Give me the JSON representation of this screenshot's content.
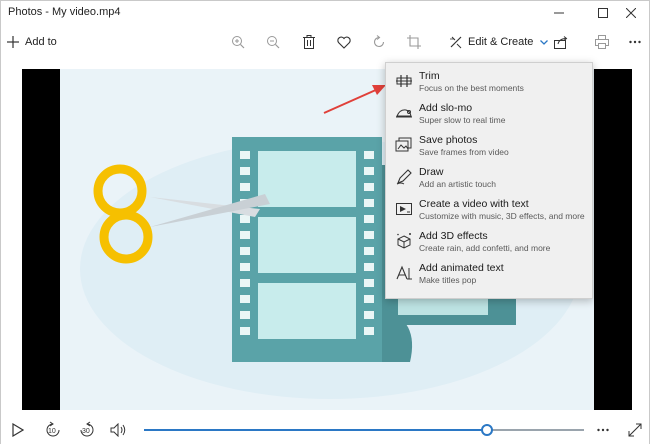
{
  "window": {
    "title": "Photos - My video.mp4"
  },
  "toolbar": {
    "add_to_label": "Add to",
    "edit_create_label": "Edit & Create",
    "icons": [
      "zoom-in-icon",
      "zoom-out-icon",
      "delete-icon",
      "heart-icon",
      "rotate-icon",
      "crop-icon",
      "share-icon",
      "print-icon",
      "more-icon"
    ]
  },
  "edit_menu": {
    "items": [
      {
        "title": "Trim",
        "subtitle": "Focus on the best moments",
        "icon": "trim-icon"
      },
      {
        "title": "Add slo-mo",
        "subtitle": "Super slow to real time",
        "icon": "slomo-icon"
      },
      {
        "title": "Save photos",
        "subtitle": "Save frames from video",
        "icon": "save-photos-icon"
      },
      {
        "title": "Draw",
        "subtitle": "Add an artistic touch",
        "icon": "draw-icon"
      },
      {
        "title": "Create a video with text",
        "subtitle": "Customize with music, 3D effects, and more",
        "icon": "video-text-icon"
      },
      {
        "title": "Add 3D effects",
        "subtitle": "Create rain, add confetti, and more",
        "icon": "3d-effects-icon"
      },
      {
        "title": "Add animated text",
        "subtitle": "Make titles pop",
        "icon": "animated-text-icon"
      }
    ]
  },
  "player": {
    "skip_back_label": "10",
    "skip_forward_label": "30",
    "progress": 0.78
  },
  "colors": {
    "accent": "#2b78c5",
    "film": "#5aa3a8",
    "film_light": "#c8ecec",
    "scissor_handle": "#f6c000",
    "blade": "#d8dde1",
    "arrow": "#e0403a",
    "letterbox": "#000000"
  }
}
